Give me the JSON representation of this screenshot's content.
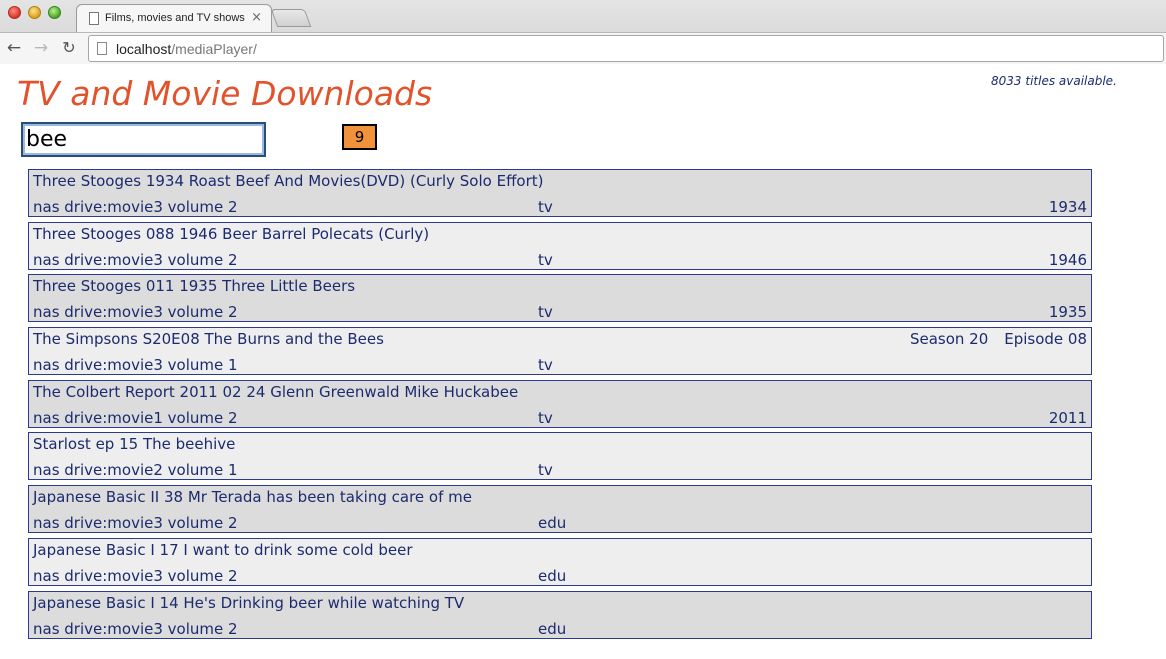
{
  "browser": {
    "tab_title": "Films, movies and TV shows",
    "tab_close": "×",
    "url_host": "localhost",
    "url_path": "/mediaPlayer/",
    "back": "←",
    "forward": "→",
    "reload": "↻"
  },
  "header": {
    "title": "TV and Movie Downloads",
    "titles_count": "8033",
    "titles_label": "titles available."
  },
  "search": {
    "value": "bee",
    "result_count": "9"
  },
  "colors": {
    "title": "#e2532c",
    "badge": "#f0923a",
    "text": "#1c2b6e",
    "row_border": "#2b3a8c"
  },
  "results": [
    {
      "title": "Three Stooges 1934 Roast Beef And Movies(DVD) (Curly Solo Effort)",
      "location": "nas drive:movie3 volume 2",
      "type": "tv",
      "year": "1934",
      "season": "",
      "episode": ""
    },
    {
      "title": "Three Stooges 088 1946 Beer Barrel Polecats (Curly)",
      "location": "nas drive:movie3 volume 2",
      "type": "tv",
      "year": "1946",
      "season": "",
      "episode": ""
    },
    {
      "title": "Three Stooges 011 1935 Three Little Beers",
      "location": "nas drive:movie3 volume 2",
      "type": "tv",
      "year": "1935",
      "season": "",
      "episode": ""
    },
    {
      "title": "The Simpsons S20E08 The Burns and the Bees",
      "location": "nas drive:movie3 volume 1",
      "type": "tv",
      "year": "",
      "season": "Season 20",
      "episode": "Episode 08"
    },
    {
      "title": "The Colbert Report 2011 02 24 Glenn Greenwald Mike Huckabee",
      "location": "nas drive:movie1 volume 2",
      "type": "tv",
      "year": "2011",
      "season": "",
      "episode": ""
    },
    {
      "title": "Starlost ep 15 The beehive",
      "location": "nas drive:movie2 volume 1",
      "type": "tv",
      "year": "",
      "season": "",
      "episode": ""
    },
    {
      "title": "Japanese Basic II 38 Mr Terada has been taking care of me",
      "location": "nas drive:movie3 volume 2",
      "type": "edu",
      "year": "",
      "season": "",
      "episode": ""
    },
    {
      "title": "Japanese Basic I 17 I want to drink some cold beer",
      "location": "nas drive:movie3 volume 2",
      "type": "edu",
      "year": "",
      "season": "",
      "episode": ""
    },
    {
      "title": "Japanese Basic I 14 He's Drinking beer while watching TV",
      "location": "nas drive:movie3 volume 2",
      "type": "edu",
      "year": "",
      "season": "",
      "episode": ""
    }
  ]
}
